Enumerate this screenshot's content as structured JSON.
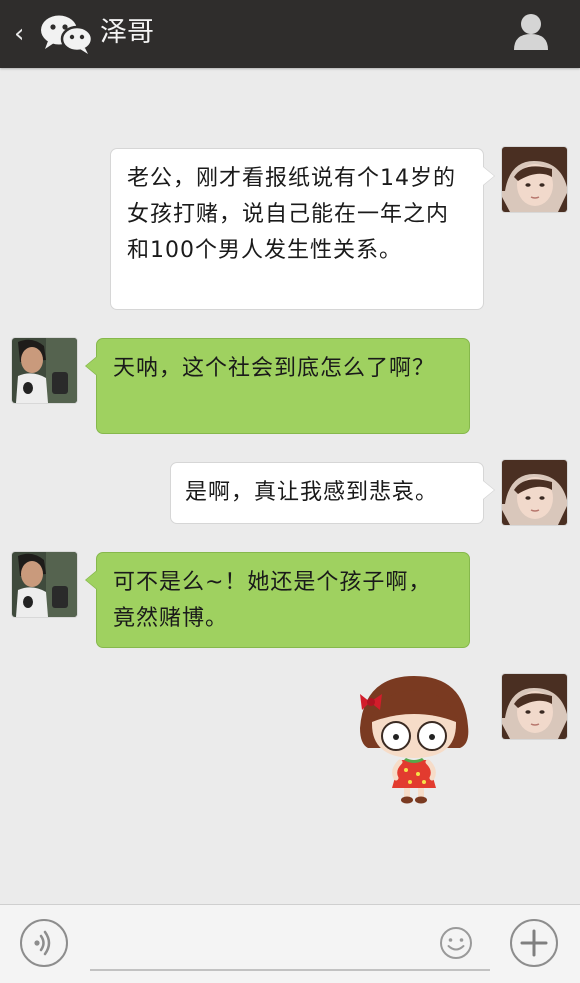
{
  "header": {
    "title": "泽哥",
    "back_icon": "chevron-left-icon",
    "logo_icon": "wechat-logo-icon",
    "profile_icon": "person-icon",
    "background": "#2f2d2c"
  },
  "messages": [
    {
      "side": "right",
      "sender": "self",
      "text": "老公，刚才看报纸说有个14岁的女孩打赌，说自己能在一年之内和100个男人发生性关系。"
    },
    {
      "side": "left",
      "sender": "泽哥",
      "text": "天呐，这个社会到底怎么了啊？"
    },
    {
      "side": "right",
      "sender": "self",
      "text": "是啊，真让我感到悲哀。"
    },
    {
      "side": "left",
      "sender": "泽哥",
      "text": "可不是么~！她还是个孩子啊，竟然赌博。"
    },
    {
      "side": "right",
      "sender": "self",
      "type": "sticker",
      "sticker": "cartoon-girl-sticker"
    }
  ],
  "input_bar": {
    "voice_icon": "voice-input-icon",
    "text_value": "",
    "emoji_icon": "smiley-icon",
    "plus_icon": "plus-icon"
  },
  "colors": {
    "chat_background": "#ebebeb",
    "own_bubble": "#ffffff",
    "other_bubble": "#9fd160"
  }
}
